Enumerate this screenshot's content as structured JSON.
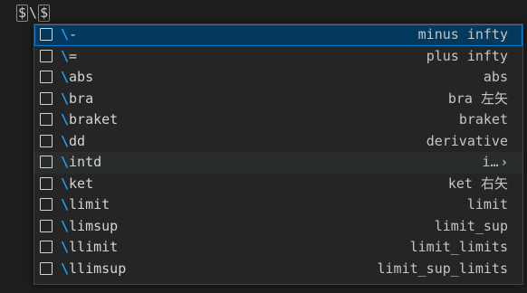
{
  "editor": {
    "prefix": "$",
    "typed": "\\",
    "suffix": "$"
  },
  "suggestions": [
    {
      "prefix": "\\",
      "rest": "-",
      "detail": "minus infty",
      "state": "selected"
    },
    {
      "prefix": "\\",
      "rest": "=",
      "detail": "plus infty",
      "state": "normal"
    },
    {
      "prefix": "\\",
      "rest": "abs",
      "detail": "abs",
      "state": "normal"
    },
    {
      "prefix": "\\",
      "rest": "bra",
      "detail": "bra 左矢",
      "state": "normal"
    },
    {
      "prefix": "\\",
      "rest": "braket",
      "detail": "braket",
      "state": "normal"
    },
    {
      "prefix": "\\",
      "rest": "dd",
      "detail": "derivative",
      "state": "normal"
    },
    {
      "prefix": "\\",
      "rest": "intd",
      "detail": "i…",
      "state": "hover",
      "chevron": "›"
    },
    {
      "prefix": "\\",
      "rest": "ket",
      "detail": "ket 右矢",
      "state": "normal"
    },
    {
      "prefix": "\\",
      "rest": "limit",
      "detail": "limit",
      "state": "normal"
    },
    {
      "prefix": "\\",
      "rest": "limsup",
      "detail": "limit_sup",
      "state": "normal"
    },
    {
      "prefix": "\\",
      "rest": "llimit",
      "detail": "limit_limits",
      "state": "normal"
    },
    {
      "prefix": "\\",
      "rest": "llimsup",
      "detail": "limit_sup_limits",
      "state": "normal"
    }
  ],
  "icons": {
    "kind": "snippet-icon"
  },
  "colors": {
    "background": "#1e1e1e",
    "widget": "#252526",
    "selected": "#04395e",
    "focus_border": "#007fd4",
    "match_highlight": "#18a3ff"
  }
}
